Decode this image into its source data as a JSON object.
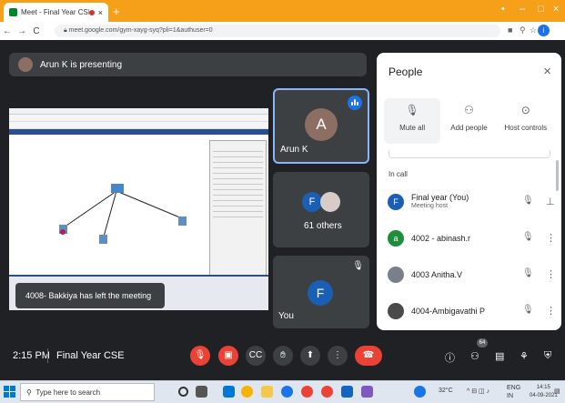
{
  "browser": {
    "tab_title": "Meet - Final Year CSE",
    "tab_close": "×",
    "new_tab": "+",
    "url": "meet.google.com/gym-xayg-syq?pli=1&authuser=0",
    "profile_initial": "i",
    "window_controls": [
      "•",
      "–",
      "□",
      "×"
    ]
  },
  "presenting": {
    "text": "Arun K is presenting"
  },
  "tiles": {
    "arun": {
      "initial": "A",
      "name": "Arun K",
      "avatar_color": "#8d6e63"
    },
    "others": {
      "initial": "F",
      "label": "61 others",
      "avatar_color": "#1a5fb4"
    },
    "you": {
      "initial": "F",
      "name": "You",
      "avatar_color": "#1a5fb4"
    }
  },
  "toast": {
    "text": "4008- Bakkiya has left the meeting"
  },
  "people_panel": {
    "title": "People",
    "close": "×",
    "actions": [
      {
        "label": "Mute all",
        "icon": "mic-off-icon"
      },
      {
        "label": "Add people",
        "icon": "add-person-icon"
      },
      {
        "label": "Host controls",
        "icon": "toggle-icon"
      }
    ],
    "section": "In call",
    "participants": [
      {
        "initial": "F",
        "name": "Final year (You)",
        "sub": "Meeting host",
        "color": "#1a5fb4"
      },
      {
        "initial": "a",
        "name": "4002 - abinash.r",
        "sub": "",
        "color": "#1e8e3e"
      },
      {
        "initial": "",
        "name": "4003 Anitha.V",
        "sub": "",
        "color": "#7a8089"
      },
      {
        "initial": "",
        "name": "4004-Ambigavathi P",
        "sub": "",
        "color": "#4a4a4a"
      }
    ]
  },
  "controls": {
    "time": "2:15 PM",
    "meeting_name": "Final Year CSE",
    "participant_count": "64"
  },
  "taskbar": {
    "search_placeholder": "Type here to search",
    "temperature": "32°C",
    "language": "ENG",
    "region": "IN",
    "time": "14:15",
    "date": "04-09-2021"
  }
}
